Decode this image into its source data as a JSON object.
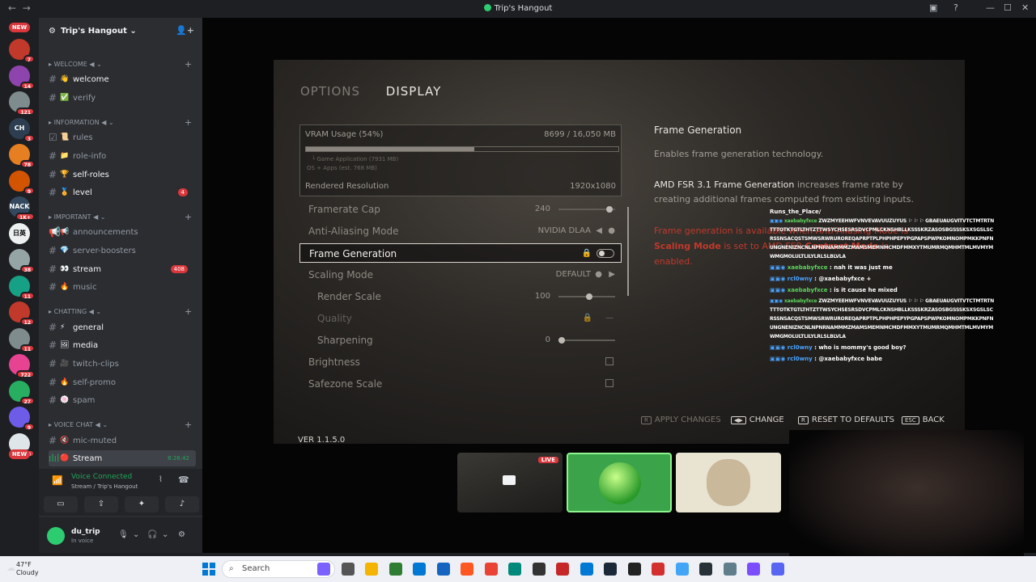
{
  "window": {
    "title": "Trip's Hangout",
    "back": "←",
    "fwd": "→"
  },
  "rail": {
    "servers": [
      {
        "label": "",
        "badge": "7"
      },
      {
        "label": "",
        "badge": "14"
      },
      {
        "label": "",
        "badge": "121"
      },
      {
        "label": "CH",
        "badge": "3"
      },
      {
        "label": "",
        "badge": "78"
      },
      {
        "label": "",
        "badge": "9"
      },
      {
        "label": "NACK",
        "badge": "1K+"
      },
      {
        "label": "日英",
        "badge": ""
      },
      {
        "label": "",
        "badge": "38"
      },
      {
        "label": "",
        "badge": "11"
      },
      {
        "label": "",
        "badge": "12"
      },
      {
        "label": "",
        "badge": "11"
      },
      {
        "label": "",
        "badge": "722"
      },
      {
        "label": "",
        "badge": "27"
      },
      {
        "label": "",
        "badge": "9"
      },
      {
        "label": "",
        "badge": "8"
      }
    ],
    "new_label": "NEW"
  },
  "guild": {
    "name": "Trip's Hangout ⌄"
  },
  "categories": {
    "welcome": "WELCOME ◀ ⌄",
    "information": "INFORMATION ◀ ⌄",
    "important": "IMPORTANT ◀ ⌄",
    "chatting": "CHATTING ◀ ⌄",
    "voice": "VOICE CHAT ◀ ⌄"
  },
  "channels": {
    "welcome": {
      "emoji": "👋",
      "name": "welcome"
    },
    "verify": {
      "emoji": "✅",
      "name": "verify"
    },
    "rules": {
      "emoji": "📜",
      "name": "rules"
    },
    "role_info": {
      "emoji": "📁",
      "name": "role-info"
    },
    "self_roles": {
      "emoji": "🏆",
      "name": "self-roles"
    },
    "level": {
      "emoji": "🏅",
      "name": "level",
      "count": "4"
    },
    "announcements": {
      "emoji": "📢",
      "name": "announcements"
    },
    "server_boosters": {
      "emoji": "💎",
      "name": "server-boosters"
    },
    "stream": {
      "emoji": "👀",
      "name": "stream",
      "count": "408"
    },
    "music": {
      "emoji": "🔥",
      "name": "music"
    },
    "general": {
      "emoji": "⚡",
      "name": "general"
    },
    "media": {
      "emoji": "🖼",
      "name": "media"
    },
    "twitch_clips": {
      "emoji": "🎥",
      "name": "twitch-clips"
    },
    "self_promo": {
      "emoji": "🔥",
      "name": "self-promo"
    },
    "spam": {
      "emoji": "🍥",
      "name": "spam"
    },
    "mic_muted": {
      "emoji": "🔇",
      "name": "mic-muted"
    },
    "stream_vc": {
      "emoji": "🔴",
      "name": "Stream",
      "time": "8:26:42"
    }
  },
  "voice_panel": {
    "status": "Voice Connected",
    "sub": "Stream / Trip's Hangout"
  },
  "user": {
    "name": "du_trip",
    "status": "In voice"
  },
  "game": {
    "tabs": [
      "OPTIONS",
      "DISPLAY"
    ],
    "vram_label": "VRAM Usage (54%)",
    "vram_value": "8699 / 16,050 MB",
    "vram_fraction": 0.54,
    "vram_sub1": "└ Game Application (7931 MB)",
    "vram_sub2": "OS + Apps (est. 768 MB)",
    "rendered_label": "Rendered Resolution",
    "rendered_value": "1920x1080",
    "options": [
      {
        "name": "Framerate Cap",
        "value": "240",
        "slider": 0.95
      },
      {
        "name": "Anti-Aliasing Mode",
        "value": "NVIDIA DLAA"
      },
      {
        "name": "Frame Generation",
        "value": ""
      },
      {
        "name": "Scaling Mode",
        "value": "DEFAULT"
      },
      {
        "name": "Render Scale",
        "value": "100",
        "slider": 0.55
      },
      {
        "name": "Quality",
        "value": "—"
      },
      {
        "name": "Sharpening",
        "value": "0",
        "slider": 0.0
      },
      {
        "name": "Brightness",
        "value": ""
      },
      {
        "name": "Safezone Scale",
        "value": ""
      }
    ],
    "desc_title": "Frame Generation",
    "desc_line1": "Enables frame generation technology.",
    "desc_bold": "AMD FSR 3.1 Frame Generation",
    "desc_line2": " increases frame rate by creating additional frames computed from existing inputs.",
    "warn_a": "Frame generation is available when ",
    "warn_b": "Anti-Aliasing Mode",
    "warn_c": " is ",
    "warn_d": "Scaling Mode",
    "warn_e": " is set to AMD FSR ",
    "warn_f": "Contrast Mode",
    "warn_g": " is enabled.",
    "bottom": {
      "apply": "APPLY CHANGES",
      "change": "CHANGE",
      "reset": "RESET TO DEFAULTS",
      "back": "BACK"
    },
    "version": "VER 1.1.5.0"
  },
  "chat_overlay": {
    "title": "Runs_the_Place/",
    "messages": [
      {
        "user": "xaebabyfxce",
        "text": " ZWZMYEEHWFVNVEVAVUUZUYUS ⚐ ⚐ ⚐ GBAEUAUGVITVTCTMTRTNTTTOTKTGTLTHTZTTWSYCHSESRSDVCPMLCKNSHBLLKSSSKRZASOSBGSSSKSXSGSLSCRSSNSACQSTSMWSRWRUROREQAPRPTPLPHPHPEPYPGPAPSPWPKOMNOMPMKKPNFNUNGNENIZNCNLNPNRNAMMMZMAMSMEMNMCMDFMMXYTMUMRMQMHMTMLMVMYMWMGMOLULTLILYLRLSLBLVLA"
      },
      {
        "user": "xaebabyfxce",
        "text": " : nah it was just me"
      },
      {
        "user": "rcl0wny",
        "text": " : @xaebabyfxce +",
        "blue": true
      },
      {
        "user": "xaebabyfxce",
        "text": " : is it cause he mixed"
      },
      {
        "user": "xaebabyfxce",
        "text": " ZWZMYEEHWFVNVEVAVUUZUYUS ⚐ ⚐ ⚐ GBAEUAUGVITVTCTMTRTNTTTOTKTGTLTHTZTTWSYCHSESRSDVCPMLCKNSHBLLKSSSKRZASOSBGSSSKSXSGSLSCRSSNSACQSTSMWSRWRUROREQAPRPTPLPHPHPEPYPGPAPSPWPKOMNOMPMKKPNFNUNGNENIZNCNLNPNRNAMMMZMAMSMEMNMCMDFMMXYTMUMRMQMHMTMLMVMYMWMGMOLULTLILYLRLSLBLVLA"
      },
      {
        "user": "rcl0wny",
        "text": " : who is mommy's good boy?",
        "blue": true
      },
      {
        "user": "rcl0wny",
        "text": " : @xaebabyfxce babe",
        "blue": true
      }
    ]
  },
  "tiles": {
    "live": "LIVE"
  },
  "taskbar": {
    "temp": "47°F",
    "weather": "Cloudy",
    "search": "Search"
  }
}
